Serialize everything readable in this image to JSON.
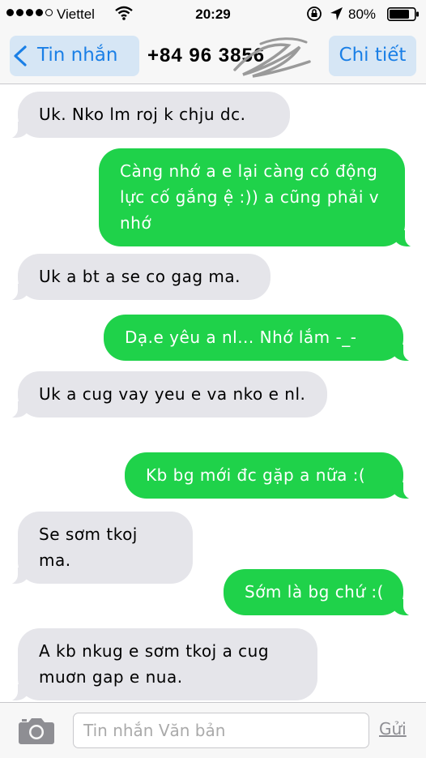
{
  "status_bar": {
    "carrier": "Viettel",
    "time": "20:29",
    "battery_percent": "80%",
    "battery_level": 0.8,
    "signal_bars_filled": 4,
    "signal_bars_total": 5,
    "icons": [
      "wifi-icon",
      "rotation-lock-icon",
      "location-icon",
      "battery-icon"
    ]
  },
  "nav": {
    "back_label": "Tin nhắn",
    "contact_number": "+84 96 3856",
    "details_label": "Chi tiết",
    "accent_color": "#1a7fe6"
  },
  "messages": [
    {
      "direction": "in",
      "text": "Uk. Nko lm roj k chju dc."
    },
    {
      "direction": "out",
      "text": "Càng nhớ a e lại càng có động lực cố gắng ệ :)) a cũng phải v nhớ"
    },
    {
      "direction": "in",
      "text": "Uk a bt a se co gag ma."
    },
    {
      "direction": "out",
      "text": "Dạ.e yêu a nl... Nhớ lắm -_-"
    },
    {
      "direction": "in",
      "text": "Uk a cug vay yeu e va nko e nl."
    },
    {
      "direction": "out",
      "text": "Kb bg mới đc gặp a nữa :("
    },
    {
      "direction": "in",
      "text": "Se sơm tkoj ma."
    },
    {
      "direction": "out",
      "text": "Sớm là bg chứ :("
    },
    {
      "direction": "in",
      "text": "A kb nkug e sơm tkoj a cug muơn gap e nua."
    }
  ],
  "colors": {
    "incoming_bubble": "#e5e5ea",
    "outgoing_bubble": "#1fd24a"
  },
  "composer": {
    "placeholder": "Tin nhắn Văn bản",
    "value": "",
    "send_label": "Gửi",
    "camera_icon": "camera-icon"
  }
}
